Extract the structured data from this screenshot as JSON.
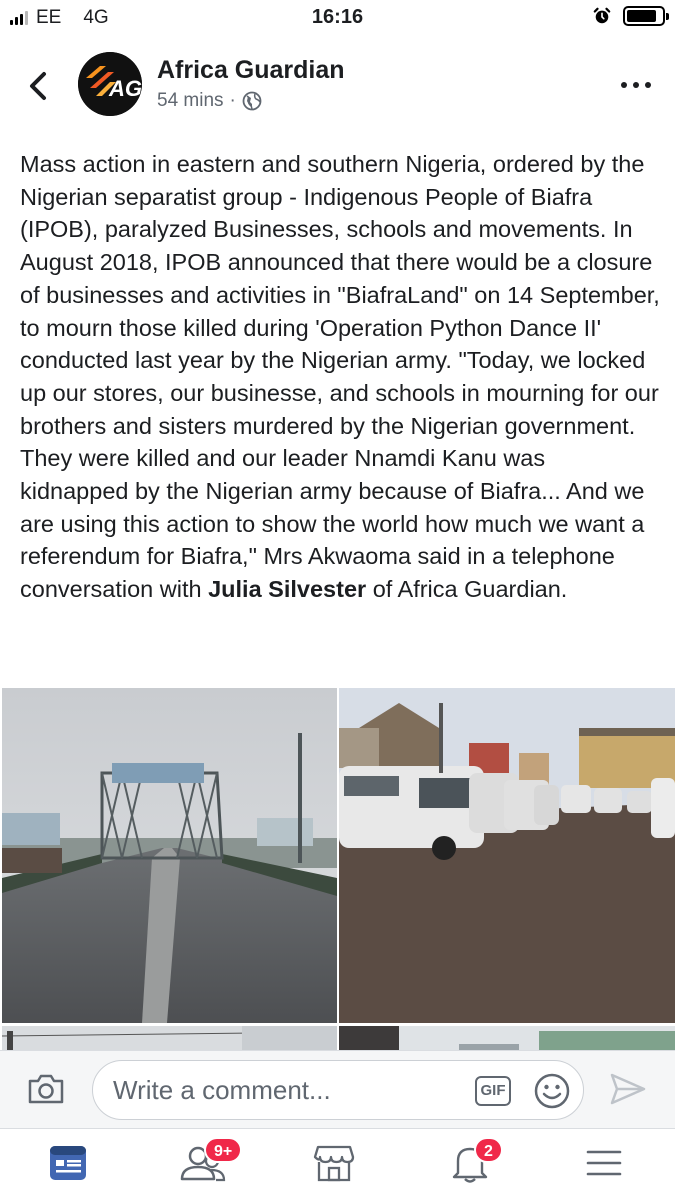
{
  "status_bar": {
    "carrier": "EE",
    "network": "4G",
    "time": "16:16",
    "battery_level": 0.85
  },
  "post": {
    "page_name": "Africa Guardian",
    "avatar_text": "AG",
    "time_ago": "54 mins",
    "separator": "·",
    "privacy_icon": "globe-icon",
    "text_main": "Mass action in eastern and southern Nigeria, ordered by the Nigerian separatist group - Indigenous People of Biafra (IPOB), paralyzed Businesses, schools and movements. In August 2018, IPOB announced that there would be a closure of businesses and activities in \"BiafraLand\" on 14 September, to mourn those killed during 'Operation Python Dance II' conducted last year by the Nigerian army. \"Today, we locked up our stores, our businesse, and schools in mourning for our brothers and sisters murdered by the Nigerian government. They were killed and our leader Nnamdi Kanu was kidnapped by the Nigerian army because of Biafra... And we are using this action to show the world how much we want a referendum for Biafra,\" Mrs Akwaoma said in a telephone conversation with ",
    "text_bold": "Julia Silvester",
    "text_end": " of Africa Guardian."
  },
  "comment_bar": {
    "placeholder": "Write a comment...",
    "gif_label": "GIF"
  },
  "bottom_nav": {
    "items": [
      {
        "name": "news-feed",
        "icon": "news-feed-icon"
      },
      {
        "name": "friends",
        "icon": "friends-icon",
        "badge": "9+"
      },
      {
        "name": "marketplace",
        "icon": "marketplace-icon"
      },
      {
        "name": "notifications",
        "icon": "bell-icon",
        "badge": "2"
      },
      {
        "name": "menu",
        "icon": "menu-icon"
      }
    ]
  },
  "colors": {
    "accent": "#4267b2",
    "badge": "#f02849",
    "text": "#1c1e21",
    "muted": "#606770"
  }
}
